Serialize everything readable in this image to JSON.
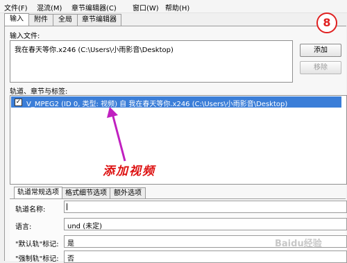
{
  "menu": {
    "items": [
      "文件(F)",
      "混流(M)",
      "章节编辑器(C)",
      "窗口(W)",
      "帮助(H)"
    ]
  },
  "top_tabs": [
    "输入",
    "附件",
    "全局",
    "章节编辑器"
  ],
  "input_files": {
    "label": "输入文件:",
    "items": [
      "我在春天等你.x246 (C:\\Users\\小雨影音\\Desktop)"
    ],
    "add_button": "添加",
    "remove_button": "移除"
  },
  "tracks": {
    "label": "轨道、章节与标签:",
    "items": [
      {
        "checked": true,
        "text": "V_MPEG2 (ID 0, 类型: 视频) 自 我在春天等你.x246 (C:\\Users\\小雨影音\\Desktop)"
      }
    ]
  },
  "annotation": {
    "step_number": "8",
    "caption": "添加视频",
    "color": "#dd1111",
    "arrow_color": "#c020c0"
  },
  "bottom_tabs": [
    "轨道常规选项",
    "格式细节选项",
    "额外选项"
  ],
  "properties": {
    "track_name_label": "轨道名称:",
    "track_name_value": "",
    "language_label": "语言:",
    "language_value": "und (未定)",
    "default_track_label": "\"默认轨\"标记:",
    "default_track_value": "是",
    "forced_track_label": "\"强制轨\"标记:",
    "forced_track_value": "否"
  },
  "watermark": "Baidu经验",
  "colors": {
    "selection": "#3b7ed8",
    "panel": "#f7f7f7"
  }
}
